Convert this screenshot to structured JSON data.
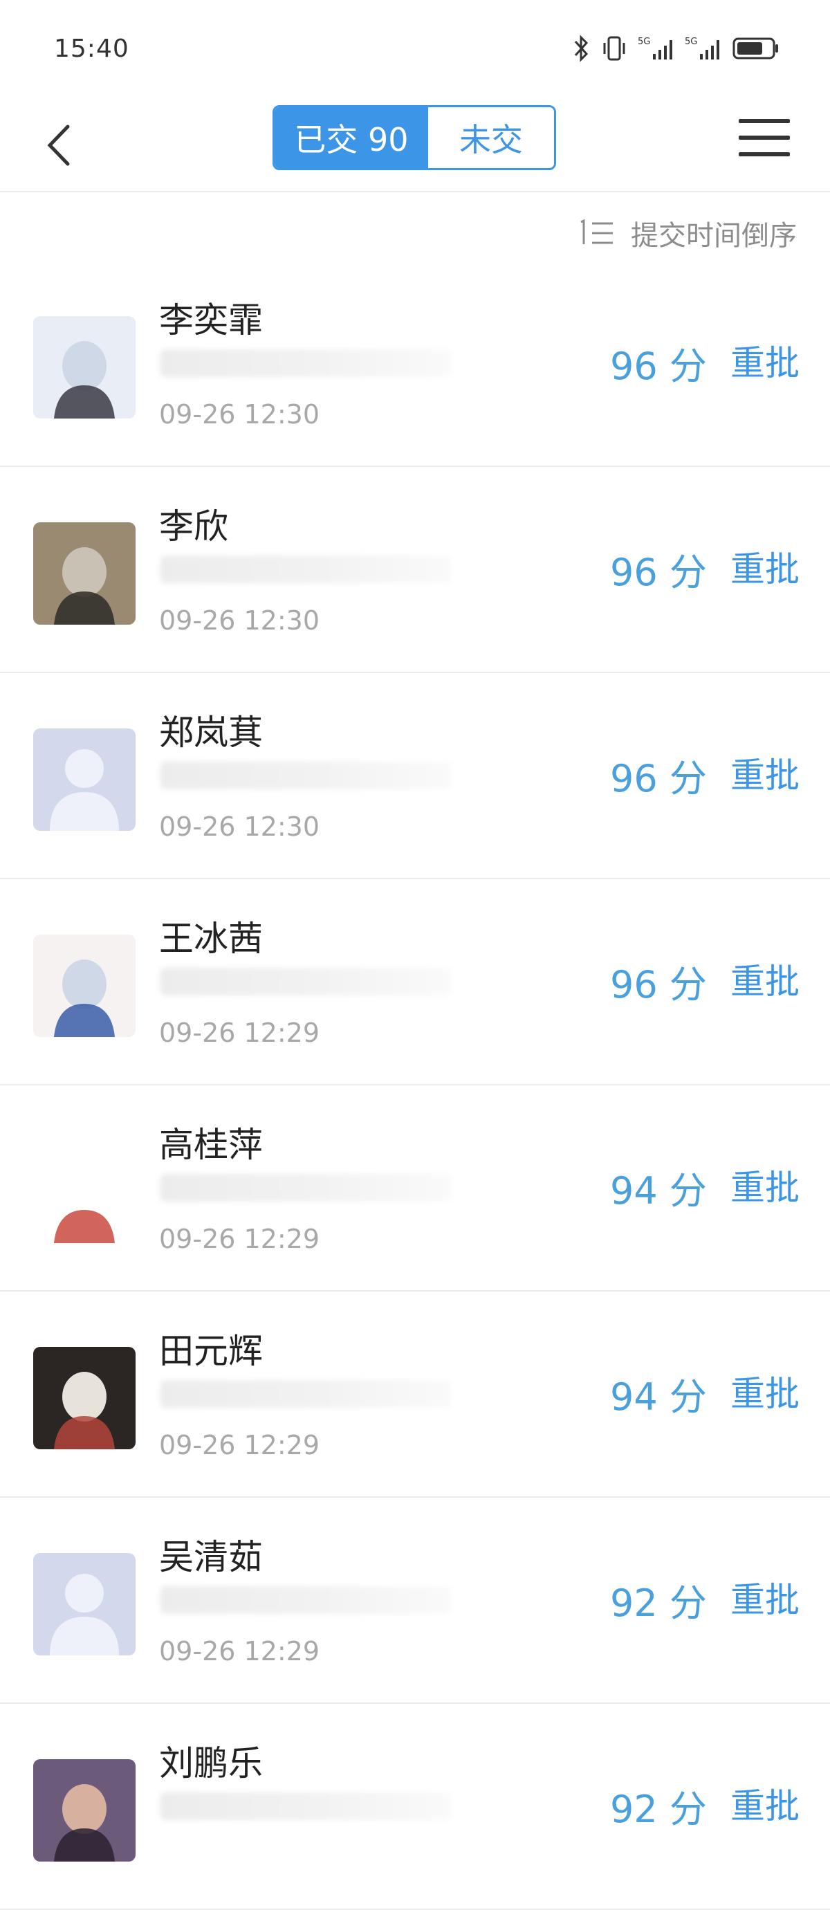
{
  "status": {
    "time": "15:40"
  },
  "header": {
    "submitted_tab": "已交 90",
    "unsubmitted_tab": "未交"
  },
  "sort": {
    "label": "提交时间倒序"
  },
  "colors": {
    "accent": "#3d95e7",
    "score": "#4aa0dc",
    "muted": "#a8a8a8"
  },
  "students": [
    {
      "name": "李奕霏",
      "time": "09-26 12:30",
      "score": "96 分",
      "action": "重批",
      "avatar": "photo"
    },
    {
      "name": "李欣",
      "time": "09-26 12:30",
      "score": "96 分",
      "action": "重批",
      "avatar": "photo"
    },
    {
      "name": "郑岚萁",
      "time": "09-26 12:30",
      "score": "96 分",
      "action": "重批",
      "avatar": "default"
    },
    {
      "name": "王冰茜",
      "time": "09-26 12:29",
      "score": "96 分",
      "action": "重批",
      "avatar": "photo"
    },
    {
      "name": "高桂萍",
      "time": "09-26 12:29",
      "score": "94 分",
      "action": "重批",
      "avatar": "photo"
    },
    {
      "name": "田元辉",
      "time": "09-26 12:29",
      "score": "94 分",
      "action": "重批",
      "avatar": "photo"
    },
    {
      "name": "吴清茹",
      "time": "09-26 12:29",
      "score": "92 分",
      "action": "重批",
      "avatar": "default"
    },
    {
      "name": "刘鹏乐",
      "time": "",
      "score": "92 分",
      "action": "重批",
      "avatar": "photo"
    }
  ]
}
